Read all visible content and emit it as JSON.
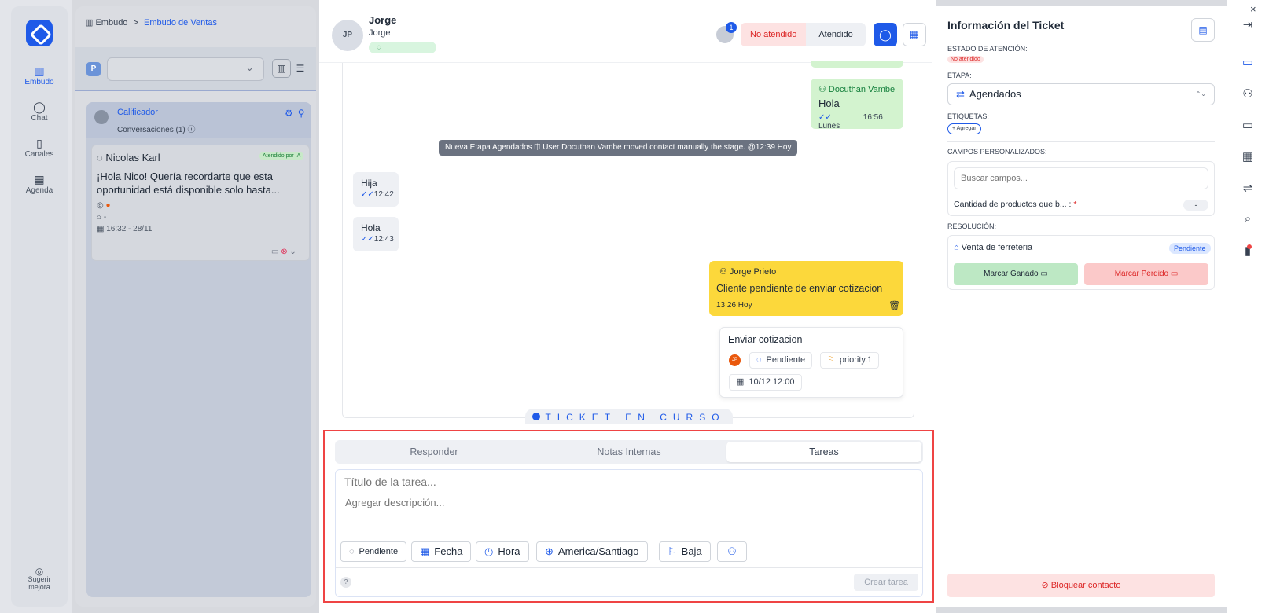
{
  "sidebar": {
    "items": [
      {
        "label": "Embudo",
        "icon": "columns-icon"
      },
      {
        "label": "Chat",
        "icon": "chat-icon"
      },
      {
        "label": "Canales",
        "icon": "device-icon"
      },
      {
        "label": "Agenda",
        "icon": "calendar-icon"
      }
    ],
    "suggest": "Sugerir mejora"
  },
  "kanban": {
    "breadcrumb_root": "Embudo",
    "breadcrumb_sep": ">",
    "breadcrumb_current": "Embudo de Ventas",
    "filter_badge": "P",
    "column": {
      "title": "Calificador",
      "subtitle": "Conversaciones (1)"
    },
    "card": {
      "name": "Nicolas Karl",
      "badge": "Atendido por IA",
      "message": "¡Hola Nico! Quería recordarte que esta oportunidad está disponible solo hasta...",
      "tags": "-",
      "datetime": "16:32 - 28/11"
    }
  },
  "chat": {
    "contact_initials": "JP",
    "contact_name": "Jorge",
    "contact_sub": "Jorge",
    "agent_count": "1",
    "status_unattended": "No atendido",
    "status_attended": "Atendido",
    "messages": {
      "out1": {
        "author": "Docuthan Vambe",
        "text": "Hola",
        "time": "16:56 Lunes"
      },
      "system": "Nueva Etapa Agendados  ⎅ User Docuthan Vambe moved contact manually the stage.  @12:39 Hoy",
      "in1": {
        "text": "Hija",
        "time": "12:42"
      },
      "in2": {
        "text": "Hola",
        "time": "12:43"
      },
      "note": {
        "author": "Jorge Prieto",
        "text": "Cliente pendiente de enviar cotizacion",
        "time": "13:26 Hoy"
      },
      "task": {
        "title": "Enviar cotizacion",
        "avatar": "JP",
        "status": "Pendiente",
        "priority": "priority.1",
        "date": "10/12 12:00"
      }
    },
    "ticket_banner": "TICKET EN CURSO"
  },
  "composer": {
    "tabs": [
      "Responder",
      "Notas Internas",
      "Tareas"
    ],
    "title_placeholder": "Título de la tarea...",
    "desc_placeholder": "Agregar descripción...",
    "chips": {
      "status": "Pendiente",
      "date": "Fecha",
      "time": "Hora",
      "timezone": "America/Santiago",
      "priority": "Baja"
    },
    "help": "?",
    "create": "Crear tarea"
  },
  "info": {
    "title": "Información del Ticket",
    "estado_label": "ESTADO DE ATENCIÓN:",
    "estado_value": "No atendido",
    "etapa_label": "ETAPA:",
    "etapa_value": "Agendados",
    "etiquetas_label": "ETIQUETAS:",
    "agregar": "+ Agregar",
    "campos_label": "CAMPOS PERSONALIZADOS:",
    "buscar_placeholder": "Buscar campos...",
    "cantidad_label": "Cantidad de productos que b... :",
    "cantidad_req": "*",
    "cantidad_value": "-",
    "resolucion_label": "RESOLUCIÓN:",
    "venta": "Venta de ferreteria",
    "venta_status": "Pendiente",
    "ganado": "Marcar Ganado",
    "perdido": "Marcar Perdido",
    "bloquear": "Bloquear contacto"
  },
  "colors": {
    "accent": "#1f5ae8",
    "danger": "#dc2626",
    "highlight": "#ef4444"
  }
}
